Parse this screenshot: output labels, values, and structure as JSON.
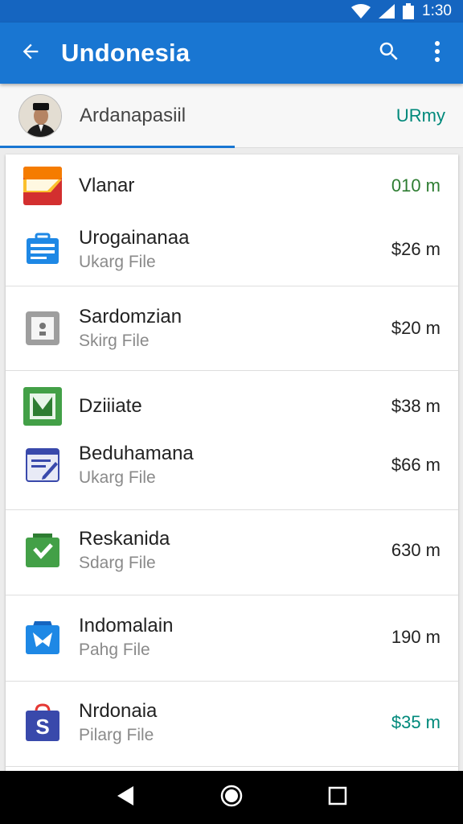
{
  "status_bar": {
    "time": "1:30",
    "icons": [
      "wifi-icon",
      "signal-icon",
      "battery-icon"
    ]
  },
  "app_bar": {
    "title": "Undonesia",
    "back_icon": "arrow-back-icon",
    "search_icon": "search-icon",
    "more_icon": "more-vert-icon"
  },
  "account": {
    "name": "Ardanapasiil",
    "action": "URmy"
  },
  "colors": {
    "primary": "#1976d2",
    "status": "#1565c0",
    "green": "#2e7d32",
    "teal": "#00897b"
  },
  "items": [
    {
      "icon": "card-icon",
      "title": "Vlanar",
      "subtitle": "",
      "value": "010 m",
      "value_color": "#2e7d32"
    },
    {
      "icon": "briefcase-icon",
      "title": "Urogainanaa",
      "subtitle": "Ukarg File",
      "value": "$26 m",
      "value_color": "#222222"
    },
    {
      "icon": "document-box-icon",
      "title": "Sardomzian",
      "subtitle": "Skirg File",
      "value": "$20 m",
      "value_color": "#222222"
    },
    {
      "icon": "checkbox-icon",
      "title": "Dziiiate",
      "subtitle": "",
      "value": "$38 m",
      "value_color": "#222222"
    },
    {
      "icon": "notes-icon",
      "title": "Beduhamana",
      "subtitle": "Ukarg File",
      "value": "$66 m",
      "value_color": "#222222"
    },
    {
      "icon": "check-bag-icon",
      "title": "Reskanida",
      "subtitle": "Sdarg File",
      "value": "630 m",
      "value_color": "#222222"
    },
    {
      "icon": "camera-icon",
      "title": "Indomalain",
      "subtitle": "Pahg File",
      "value": "190 m",
      "value_color": "#222222"
    },
    {
      "icon": "shopping-bag-icon",
      "title": "Nrdonaia",
      "subtitle": "Pilarg File",
      "value": "$35 m",
      "value_color": "#00897b"
    }
  ],
  "nav": {
    "back": "nav-back-icon",
    "home": "nav-home-icon",
    "recents": "nav-recents-icon"
  }
}
